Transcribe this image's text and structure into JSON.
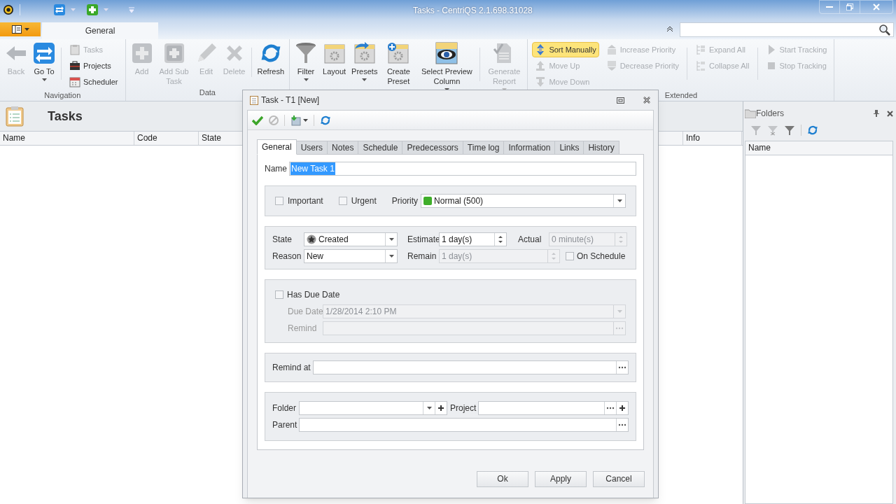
{
  "window": {
    "title": "Tasks - CentriQS 2.1.698.31028"
  },
  "ribbon_tabs": [
    {
      "label": "General",
      "selected": true
    }
  ],
  "ribbon_groups": [
    {
      "label": "Navigation",
      "items": [
        {
          "kind": "large",
          "label": "Back",
          "disabled": true
        },
        {
          "kind": "large",
          "label": "Go To",
          "disabled": false,
          "dropdown": true
        },
        {
          "kind": "stack",
          "items": [
            {
              "label": "Tasks",
              "disabled": true,
              "checked": false
            },
            {
              "label": "Projects",
              "disabled": false,
              "checked": false
            },
            {
              "label": "Scheduler",
              "disabled": false,
              "checked": false
            }
          ]
        }
      ]
    },
    {
      "label": "Data",
      "items": [
        {
          "kind": "large",
          "label": "Add",
          "disabled": true
        },
        {
          "kind": "large",
          "label": "Add Sub Task",
          "disabled": true
        },
        {
          "kind": "large",
          "label": "Edit",
          "disabled": true
        },
        {
          "kind": "large",
          "label": "Delete",
          "disabled": true
        },
        {
          "kind": "large",
          "label": "Refresh",
          "disabled": false
        }
      ]
    },
    {
      "items": [
        {
          "kind": "large",
          "label": "Filter",
          "disabled": false,
          "dropdown": true
        },
        {
          "kind": "large",
          "label": "Layout",
          "disabled": false
        },
        {
          "kind": "large",
          "label": "Presets",
          "disabled": false,
          "dropdown": true
        },
        {
          "kind": "large",
          "label": "Create Preset",
          "disabled": false
        },
        {
          "kind": "large",
          "label": "Select Preview Column",
          "disabled": false,
          "dropdown": true
        },
        {
          "kind": "large",
          "label": "Generate Report",
          "disabled": true,
          "dropdown": true
        }
      ]
    },
    {
      "label": "Extended",
      "items": [
        {
          "kind": "stack",
          "items": [
            {
              "label": "Sort Manually",
              "disabled": false,
              "checked": true
            },
            {
              "label": "Move Up",
              "disabled": true,
              "checked": false
            },
            {
              "label": "Move Down",
              "disabled": true,
              "checked": false
            }
          ]
        },
        {
          "kind": "stack",
          "items": [
            {
              "label": "Increase Priority",
              "disabled": true,
              "checked": false
            },
            {
              "label": "Decrease Priority",
              "disabled": true,
              "checked": false
            }
          ]
        },
        {
          "kind": "stack",
          "items": [
            {
              "label": "Expand All",
              "disabled": true,
              "checked": false
            },
            {
              "label": "Collapse All",
              "disabled": true,
              "checked": false
            }
          ]
        },
        {
          "kind": "stack",
          "items": [
            {
              "label": "Start Tracking",
              "disabled": true,
              "checked": false
            },
            {
              "label": "Stop Tracking",
              "disabled": true,
              "checked": false
            }
          ]
        }
      ]
    }
  ],
  "page": {
    "title": "Tasks",
    "columns": [
      "Name",
      "Code",
      "State",
      "Info"
    ]
  },
  "folders_panel": {
    "title": "Folders",
    "columns": [
      "Name"
    ]
  },
  "dialog": {
    "title": "Task - T1 [New]",
    "tabs": [
      {
        "label": "General",
        "selected": true
      },
      {
        "label": "Users",
        "selected": false
      },
      {
        "label": "Notes",
        "selected": false
      },
      {
        "label": "Schedule",
        "selected": false
      },
      {
        "label": "Predecessors",
        "selected": false
      },
      {
        "label": "Time log",
        "selected": false
      },
      {
        "label": "Information",
        "selected": false
      },
      {
        "label": "Links",
        "selected": false
      },
      {
        "label": "History",
        "selected": false
      }
    ],
    "name": {
      "label": "Name",
      "value": "New Task 1",
      "text_selected": true
    },
    "important": {
      "label": "Important",
      "checked": false
    },
    "urgent": {
      "label": "Urgent",
      "checked": false
    },
    "priority": {
      "label": "Priority",
      "value": "Normal (500)",
      "color": "#3fae2a"
    },
    "state": {
      "label": "State",
      "value": "Created"
    },
    "estimate": {
      "label": "Estimate",
      "value": "1 day(s)",
      "disabled": false
    },
    "actual": {
      "label": "Actual",
      "value": "0 minute(s)",
      "disabled": true
    },
    "reason": {
      "label": "Reason",
      "value": "New"
    },
    "remain": {
      "label": "Remain",
      "value": "1 day(s)",
      "disabled": true
    },
    "on_schedule": {
      "label": "On Schedule",
      "checked": false
    },
    "has_due_date": {
      "label": "Has Due Date",
      "checked": false
    },
    "due_date": {
      "label": "Due Date",
      "value": "1/28/2014 2:10 PM",
      "disabled": true
    },
    "remind": {
      "label": "Remind",
      "disabled": true
    },
    "remind_at": {
      "label": "Remind at"
    },
    "folder": {
      "label": "Folder"
    },
    "project": {
      "label": "Project"
    },
    "parent": {
      "label": "Parent"
    },
    "buttons": [
      "Ok",
      "Apply",
      "Cancel"
    ]
  }
}
